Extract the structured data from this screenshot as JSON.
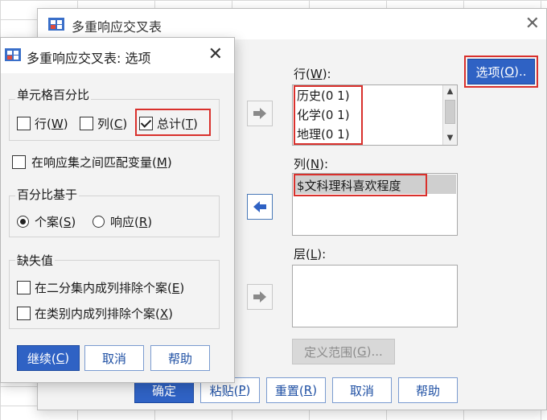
{
  "main_dialog": {
    "title": "多重响应交叉表",
    "rows_label": "行(",
    "rows_key": "W",
    "rows_label_end": "):",
    "rows_items": [
      "历史(0 1)",
      "化学(0 1)",
      "地理(0 1)"
    ],
    "cols_label": "列(",
    "cols_key": "N",
    "cols_label_end": "):",
    "cols_items": [
      "$文科理科喜欢程度"
    ],
    "layers_label": "层(",
    "layers_key": "L",
    "layers_label_end": "):",
    "options_button": {
      "text": "选项(",
      "key": "O",
      "end": ").."
    },
    "define_range_button": {
      "text": "定义范围(",
      "key": "G",
      "end": ")..."
    },
    "bottom_buttons": {
      "ok": "确定",
      "paste": {
        "text": "粘贴(",
        "key": "P",
        "end": ")"
      },
      "reset": {
        "text": "重置(",
        "key": "R",
        "end": ")"
      },
      "cancel": "取消",
      "help": "帮助"
    }
  },
  "options_dialog": {
    "title": "多重响应交叉表: 选项",
    "cell_pct": {
      "title": "单元格百分比",
      "row": {
        "text": "行(",
        "key": "W",
        "end": ")",
        "checked": false
      },
      "col": {
        "text": "列(",
        "key": "C",
        "end": ")",
        "checked": false
      },
      "total": {
        "text": "总计(",
        "key": "T",
        "end": ")",
        "checked": true
      }
    },
    "match_vars": {
      "text": "在响应集之间匹配变量(",
      "key": "M",
      "end": ")",
      "checked": false
    },
    "pct_base": {
      "title": "百分比基于",
      "cases": {
        "text": "个案(",
        "key": "S",
        "end": ")",
        "selected": true
      },
      "responses": {
        "text": "响应(",
        "key": "R",
        "end": ")",
        "selected": false
      }
    },
    "missing": {
      "title": "缺失值",
      "dichotomy": {
        "text": "在二分集内成列排除个案(",
        "key": "E",
        "end": ")",
        "checked": false
      },
      "category": {
        "text": "在类别内成列排除个案(",
        "key": "X",
        "end": ")",
        "checked": false
      }
    },
    "buttons": {
      "continue": {
        "text": "继续(",
        "key": "C",
        "end": ")"
      },
      "cancel": "取消",
      "help": "帮助"
    }
  },
  "colors": {
    "accent": "#2f62c4",
    "highlight_box": "#d9302c",
    "arrow": "#8a8a8a",
    "arrow_active": "#2f62c4"
  }
}
